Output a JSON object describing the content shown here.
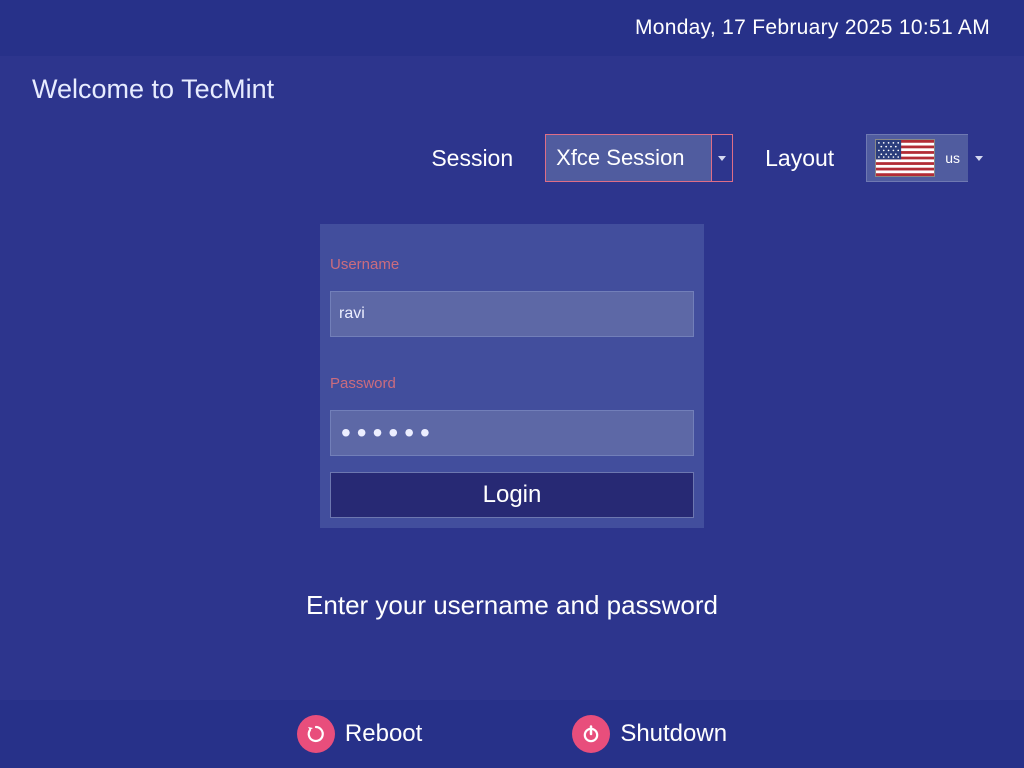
{
  "top": {
    "datetime": "Monday, 17 February 2025  10:51 AM"
  },
  "welcome": "Welcome to TecMint",
  "selectors": {
    "session_label": "Session",
    "session_value": "Xfce Session",
    "layout_label": "Layout",
    "layout_value": "us",
    "layout_flag": "us"
  },
  "login": {
    "username_label": "Username",
    "username_value": "ravi",
    "password_label": "Password",
    "password_value": "••••••",
    "login_button": "Login"
  },
  "prompt": "Enter your username and password",
  "bottom": {
    "reboot": "Reboot",
    "shutdown": "Shutdown"
  },
  "colors": {
    "bg": "#2d358d",
    "bar": "#273189",
    "panel": "#424e9d",
    "accent_pink": "#e84e7c"
  }
}
